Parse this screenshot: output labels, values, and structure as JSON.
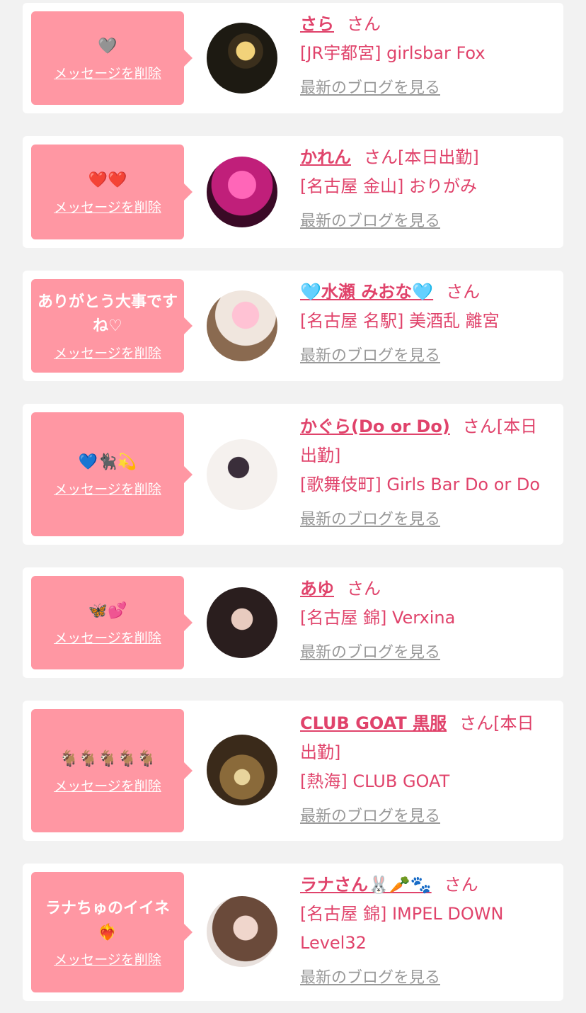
{
  "cards": [
    {
      "message": "🩶",
      "delete_label": "メッセージを削除",
      "name": "さら",
      "suffix": "さん",
      "status": "",
      "shop": "[JR宇都宮] girlsbar Fox",
      "blog_label": "最新のブログを見る"
    },
    {
      "message": "❤️❤️",
      "delete_label": "メッセージを削除",
      "name": "かれん",
      "suffix": "さん",
      "status": "[本日出勤]",
      "shop": "[名古屋 金山] おりがみ",
      "blog_label": "最新のブログを見る"
    },
    {
      "message": "ありがとう大事ですね♡",
      "delete_label": "メッセージを削除",
      "name": "🩵水瀬 みおな🩵",
      "suffix": "さん",
      "status": "",
      "shop": "[名古屋 名駅] 美酒乱 離宮",
      "blog_label": "最新のブログを見る"
    },
    {
      "message": "💙🐈‍⬛💫",
      "delete_label": "メッセージを削除",
      "name": "かぐら(Do or Do)",
      "suffix": "さん",
      "status": "[本日出勤]",
      "shop": "[歌舞伎町] Girls Bar Do or Do",
      "blog_label": "最新のブログを見る"
    },
    {
      "message": "🦋💕",
      "delete_label": "メッセージを削除",
      "name": "あゆ",
      "suffix": "さん",
      "status": "",
      "shop": "[名古屋 錦] Verxina",
      "blog_label": "最新のブログを見る"
    },
    {
      "message": "🐐🐐🐐🐐🐐",
      "delete_label": "メッセージを削除",
      "name": "CLUB GOAT 黒服",
      "suffix": "さん",
      "status": "[本日出勤]",
      "shop": "[熱海] CLUB GOAT",
      "blog_label": "最新のブログを見る"
    },
    {
      "message": "ラナちゅのイイネ❤️‍🔥",
      "delete_label": "メッセージを削除",
      "name": "ラナさん🐰🥕🐾",
      "suffix": "さん",
      "status": "",
      "shop": "[名古屋 錦] IMPEL DOWN Level32",
      "blog_label": "最新のブログを見る"
    }
  ],
  "colors": {
    "background": "#f2f2f2",
    "card": "#ffffff",
    "bubble": "#ff97a3",
    "accent": "#e0436b",
    "muted": "#999999"
  }
}
